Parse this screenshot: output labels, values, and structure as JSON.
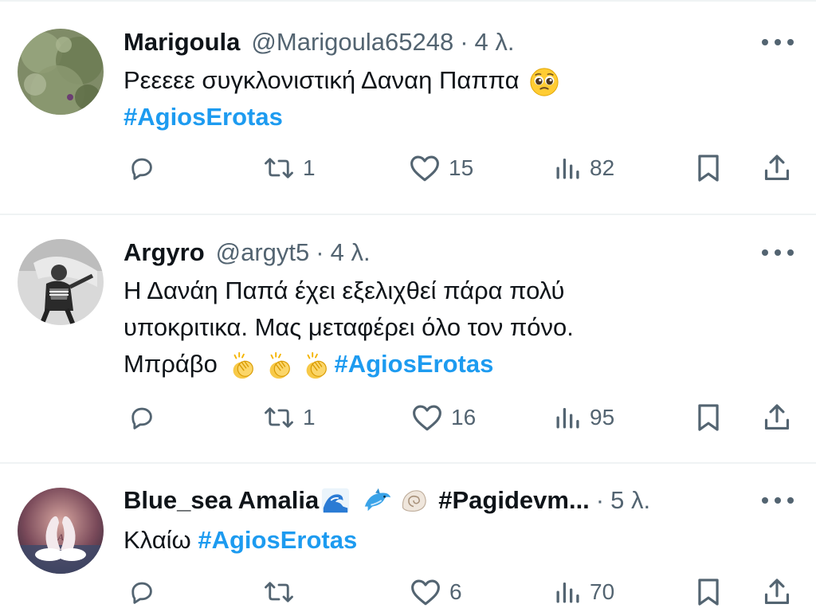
{
  "tweets": [
    {
      "name": "Marigoula",
      "handle": "@Marigoula65248",
      "dot": "·",
      "time": "4 λ.",
      "text": "Ρεεεεε συγκλονιστική Δαναη Παππα",
      "hashtag": "#AgiosErotas",
      "reply_count": "",
      "retweet_count": "1",
      "like_count": "15",
      "view_count": "82"
    },
    {
      "name": "Argyro",
      "handle": "@argyt5",
      "dot": "·",
      "time": "4 λ.",
      "text_line1": "Η Δανάη Παπά έχει εξελιχθεί πάρα πολύ",
      "text_line2": "υποκριτικα. Μας μεταφέρει όλο τον πόνο.",
      "text_line3": "Μπράβο",
      "hashtag": "#AgiosErotas",
      "reply_count": "",
      "retweet_count": "1",
      "like_count": "16",
      "view_count": "95"
    },
    {
      "name": "Blue_sea Amalia",
      "name_hashtag": "#Pagidevm...",
      "dot": "·",
      "time": "5 λ.",
      "text": "Κλαίω",
      "hashtag": "#AgiosErotas",
      "reply_count": "",
      "retweet_count": "",
      "like_count": "6",
      "view_count": "70"
    }
  ],
  "colors": {
    "text": "#0f1419",
    "secondary": "#536471",
    "hashtag": "#1d9bf0",
    "divider": "#eff3f4"
  },
  "icons": {
    "reply": "reply-icon",
    "retweet": "retweet-icon",
    "like": "heart-icon",
    "views": "views-chart-icon",
    "bookmark": "bookmark-icon",
    "share": "share-icon",
    "more": "more-dots-icon"
  }
}
